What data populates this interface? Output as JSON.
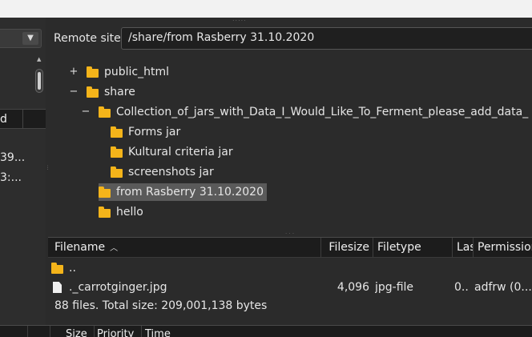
{
  "local": {
    "header_label": "d",
    "rows": [
      "39...",
      "3:..."
    ]
  },
  "remote": {
    "label": "Remote site:",
    "path": "/share/from Rasberry 31.10.2020"
  },
  "tree": {
    "items": [
      {
        "label": "public_html",
        "expander": "+"
      },
      {
        "label": "share",
        "expander": "−"
      },
      {
        "label": "Collection_of_jars_with_Data_I_Would_Like_To_Ferment_please_add_data_",
        "expander": "−"
      },
      {
        "label": "Forms jar",
        "expander": ""
      },
      {
        "label": "Kultural criteria jar",
        "expander": ""
      },
      {
        "label": "screenshots jar",
        "expander": ""
      },
      {
        "label": "from Rasberry 31.10.2020",
        "expander": "",
        "selected": true
      },
      {
        "label": "hello",
        "expander": ""
      }
    ]
  },
  "list": {
    "columns": {
      "filename": "Filename",
      "filesize": "Filesize",
      "filetype": "Filetype",
      "last_modified": "Las",
      "permissions": "Permission"
    },
    "rows": [
      {
        "name": "..",
        "size": "",
        "type": "",
        "modified": "",
        "perms": "",
        "icon": "folder-icon"
      },
      {
        "name": "._carrotginger.jpg",
        "size": "4,096",
        "type": "jpg-file",
        "modified": "0..",
        "perms": "adfrw (0...",
        "icon": "file-icon"
      }
    ],
    "status": "88 files. Total size: 209,001,138 bytes"
  },
  "queue": {
    "columns": {
      "size": "Size",
      "priority": "Priority",
      "time": "Time"
    }
  },
  "colors": {
    "folder": "#f4b41a",
    "selection": "#5a5a5a",
    "background": "#2b2b2b"
  }
}
